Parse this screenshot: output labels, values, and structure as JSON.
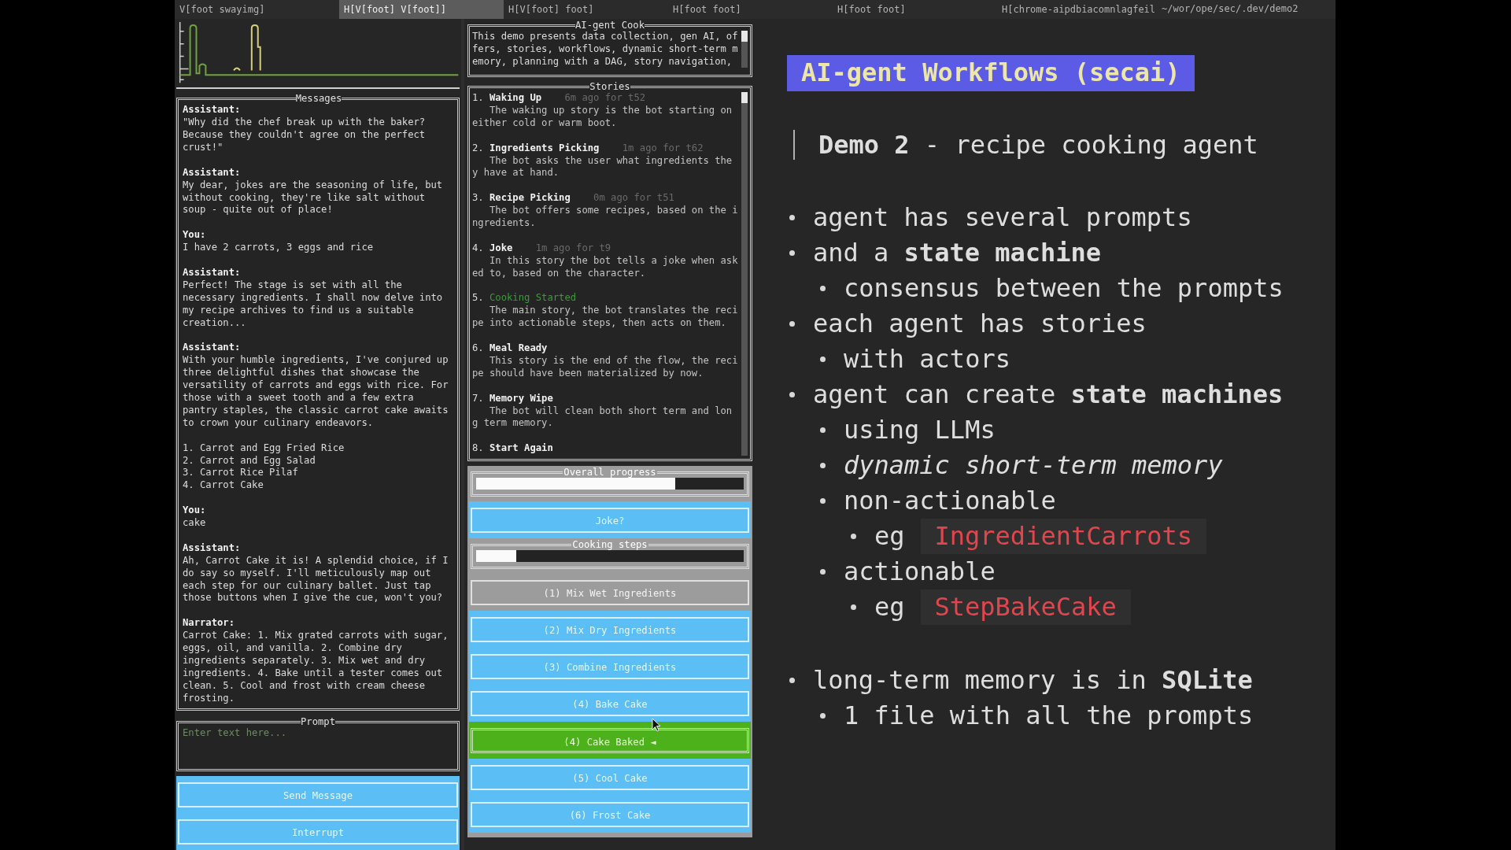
{
  "tab_bar": {
    "tabs": [
      {
        "label": "V[foot swayimg]",
        "selected": false
      },
      {
        "label": "H[V[foot] V[foot]]",
        "selected": true
      },
      {
        "label": "H[V[foot] foot]",
        "selected": false
      },
      {
        "label": "H[foot foot]",
        "selected": false
      },
      {
        "label": "H[foot foot]",
        "selected": false
      },
      {
        "label": "H[chrome-aipdbiacomnlagfeil",
        "selected": false
      }
    ],
    "path": "~/wor/ope/sec/.dev/demo2"
  },
  "messages_panel": {
    "title": "Messages",
    "messages": [
      {
        "speaker": "Assistant:",
        "text": "\"Why did the chef break up with the baker? Because they couldn't agree on the perfect crust!\""
      },
      {
        "speaker": "Assistant:",
        "text": "My dear, jokes are the seasoning of life, but without cooking, they're like salt without soup - quite out of place!"
      },
      {
        "speaker": "You:",
        "text": "I have 2 carrots, 3 eggs and rice"
      },
      {
        "speaker": "Assistant:",
        "text": "Perfect! The stage is set with all the necessary ingredients. I shall now delve into my recipe archives to find us a suitable creation..."
      },
      {
        "speaker": "Assistant:",
        "text": "With your humble ingredients, I've conjured up three delightful dishes that showcase the versatility of carrots and eggs with rice. For those with a sweet tooth and a few extra pantry staples, the classic carrot cake awaits to crown your culinary endeavors.\n\n1. Carrot and Egg Fried Rice\n2. Carrot and Egg Salad\n3. Carrot Rice Pilaf\n4. Carrot Cake"
      },
      {
        "speaker": "You:",
        "text": "cake"
      },
      {
        "speaker": "Assistant:",
        "text": "Ah, Carrot Cake it is! A splendid choice, if I do say so myself. I'll meticulously map out each step for our culinary ballet. Just tap those buttons when I give the cue, won't you?"
      },
      {
        "speaker": "Narrator:",
        "text": "Carrot Cake: 1. Mix grated carrots with sugar, eggs, oil, and vanilla. 2. Combine dry ingredients separately. 3. Mix wet and dry ingredients. 4. Bake until a tester comes out clean. 5. Cool and frost with cream cheese frosting."
      }
    ]
  },
  "prompt": {
    "title": "Prompt",
    "placeholder": "Enter text here..."
  },
  "actions": [
    "Send Message",
    "Interrupt"
  ],
  "about": {
    "title": "AI-gent Cook",
    "text": "This demo presents data collection, gen AI, offers, stories, workflows, dynamic short-term memory, planning with a DAG, story navigation,"
  },
  "stories": {
    "title": "Stories",
    "items": [
      {
        "number": "1.",
        "title": "Waking Up",
        "time": "6m ago for t52",
        "description": "The waking up story is the bot starting on either cold or warm boot.",
        "active": false
      },
      {
        "number": "2.",
        "title": "Ingredients Picking",
        "time": "1m ago for t62",
        "description": "The bot asks the user what ingredients they have at hand.",
        "active": false
      },
      {
        "number": "3.",
        "title": "Recipe Picking",
        "time": "0m ago for t51",
        "description": "The bot offers some recipes, based on the ingredients.",
        "active": false
      },
      {
        "number": "4.",
        "title": "Joke",
        "time": "1m ago for t9",
        "description": "In this story the bot tells a joke when asked to, based on the character.",
        "active": false
      },
      {
        "number": "5.",
        "title": "Cooking Started",
        "description": "The main story, the bot translates the recipe into actionable steps, then acts on them.",
        "active": true
      },
      {
        "number": "6.",
        "title": "Meal Ready",
        "description": "This story is the end of the flow, the recipe should have been materialized by now.",
        "active": false
      },
      {
        "number": "7.",
        "title": "Memory Wipe",
        "description": "The bot will clean both short term and long term memory.",
        "active": false
      },
      {
        "number": "8.",
        "title": "Start Again",
        "active": false
      }
    ]
  },
  "progress": {
    "overall": {
      "title": "Overall progress",
      "level": 0.745
    },
    "joke_button": "Joke?",
    "steps_bar": {
      "title": "Cooking steps",
      "level": 0.15
    },
    "steps": [
      {
        "label": "(1) Mix Wet Ingredients",
        "done": true,
        "current": false
      },
      {
        "label": "(2) Mix Dry Ingredients",
        "done": false,
        "current": false
      },
      {
        "label": "(3) Combine Ingredients",
        "done": false,
        "current": false
      },
      {
        "label": "(4) Bake Cake",
        "done": false,
        "current": false
      },
      {
        "label": "(4) Cake Baked ◄",
        "done": false,
        "current": true
      },
      {
        "label": "(5) Cool Cake",
        "done": false,
        "current": false
      },
      {
        "label": "(6) Frost Cake",
        "done": false,
        "current": false
      }
    ]
  },
  "slide": {
    "title": "AI-gent Workflows (secai)",
    "quote": "**Demo 2** - recipe cooking agent",
    "bullet_groups": [
      [
        {
          "kind": "plain",
          "text": "agent has several prompts"
        },
        {
          "kind": "plain",
          "text": "and a **state machine**",
          "children": [
            {
              "kind": "plain",
              "text": "consensus between the prompts"
            }
          ]
        },
        {
          "kind": "plain",
          "text": "each agent has stories",
          "children": [
            {
              "kind": "plain",
              "text": "with actors"
            }
          ]
        },
        {
          "kind": "plain",
          "text": "agent can create **state machines**",
          "children": [
            {
              "kind": "plain",
              "text": "using LLMs"
            },
            {
              "kind": "italic",
              "text": "dynamic short-term memory"
            },
            {
              "kind": "plain",
              "text": "non-actionable",
              "children": [
                {
                  "kind": "code",
                  "text": "eg",
                  "code": "IngredientCarrots"
                }
              ]
            },
            {
              "kind": "plain",
              "text": "actionable",
              "children": [
                {
                  "kind": "code",
                  "text": "eg",
                  "code": "StepBakeCake"
                }
              ]
            }
          ]
        }
      ],
      [
        {
          "kind": "plain",
          "text": "long-term memory is in **SQLite**",
          "children": [
            {
              "kind": "plain",
              "text": "1 file with all the prompts"
            }
          ]
        }
      ]
    ]
  }
}
